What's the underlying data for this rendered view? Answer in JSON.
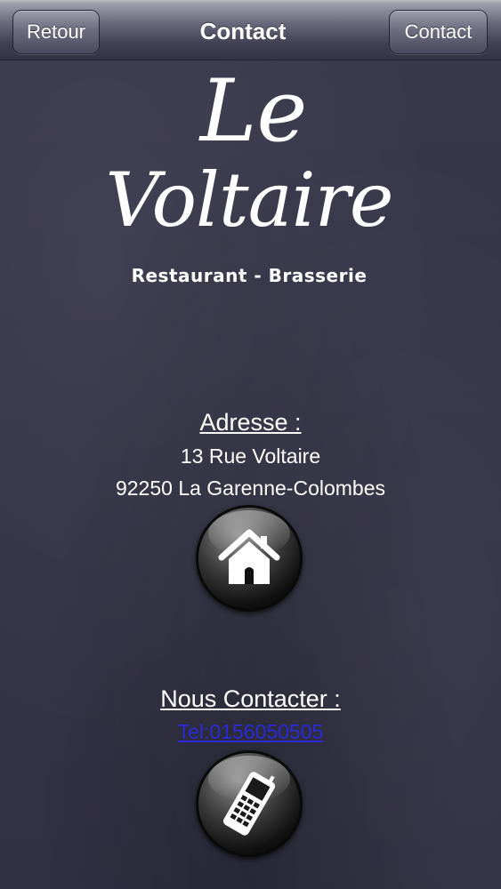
{
  "navbar": {
    "back_label": "Retour",
    "title": "Contact",
    "right_label": "Contact"
  },
  "logo": {
    "line1": "Le",
    "line2": "Voltaire",
    "subtitle": "Restaurant - Brasserie"
  },
  "address": {
    "heading": "Adresse :",
    "street": "13 Rue Voltaire",
    "city": "92250 La Garenne-Colombes",
    "icon": "home-icon"
  },
  "contact": {
    "heading": "Nous Contacter :",
    "phone": "Tel:0156050505",
    "icon": "mobile-phone-icon"
  },
  "colors": {
    "background": "#38374a",
    "link": "#2a2ad8",
    "text": "#ffffff"
  }
}
